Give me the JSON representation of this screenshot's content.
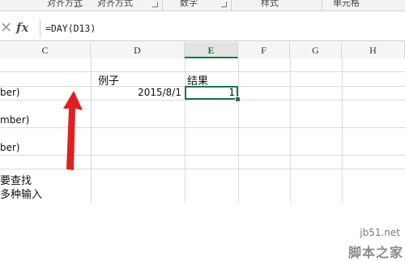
{
  "ribbon": {
    "groups": [
      {
        "label": "对齐方式"
      },
      {
        "label": "数字"
      },
      {
        "label": "样式"
      },
      {
        "label": "单元格"
      }
    ]
  },
  "formula_bar": {
    "fx_label": "fx",
    "formula": "=DAY(D13)"
  },
  "columns": [
    {
      "label": "C"
    },
    {
      "label": "D"
    },
    {
      "label": "E",
      "selected": true
    },
    {
      "label": "F"
    },
    {
      "label": "G"
    },
    {
      "label": "H"
    }
  ],
  "cells": {
    "d12": "例子",
    "e12": "结果",
    "d13": "2015/8/1",
    "e13": "1"
  },
  "left_column_fragments": [
    "ber)",
    "mber)",
    "ber)",
    "要查找",
    "多种输入"
  ],
  "colors": {
    "excel_green": "#217346",
    "annotation_red": "#e02020"
  },
  "watermark": {
    "domain": "jb51.net",
    "name": "脚本之家"
  }
}
